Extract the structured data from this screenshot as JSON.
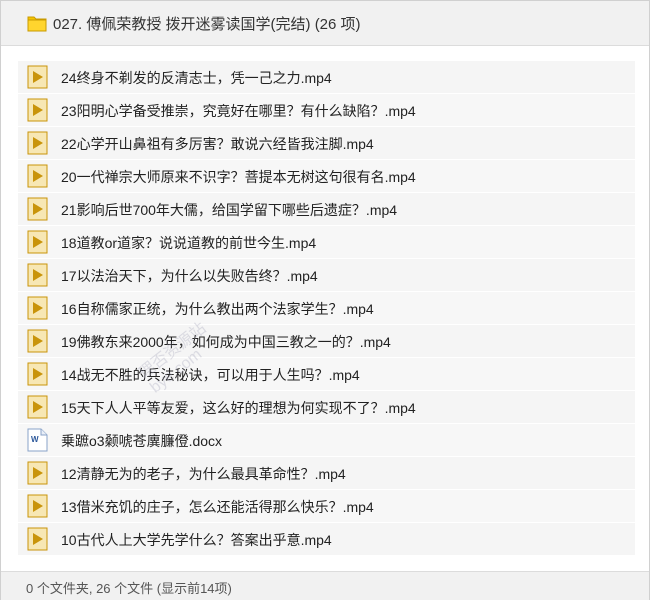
{
  "folder": {
    "title": "027. 傅佩荣教授 拨开迷雾读国学(完结) (26 项)",
    "icon": "folder-icon"
  },
  "files": [
    {
      "name": "24终身不剃发的反清志士，凭一己之力.mp4",
      "icon": "video-icon"
    },
    {
      "name": "23阳明心学备受推崇，究竟好在哪里？有什么缺陷？.mp4",
      "icon": "video-icon"
    },
    {
      "name": "22心学开山鼻祖有多厉害？敢说六经皆我注脚.mp4",
      "icon": "video-icon"
    },
    {
      "name": "20一代禅宗大师原来不识字？菩提本无树这句很有名.mp4",
      "icon": "video-icon"
    },
    {
      "name": "21影响后世700年大儒，给国学留下哪些后遗症？.mp4",
      "icon": "video-icon"
    },
    {
      "name": "18道教or道家？说说道教的前世今生.mp4",
      "icon": "video-icon"
    },
    {
      "name": "17以法治天下，为什么以失败告终？.mp4",
      "icon": "video-icon"
    },
    {
      "name": "16自称儒家正统，为什么教出两个法家学生？.mp4",
      "icon": "video-icon"
    },
    {
      "name": "19佛教东来2000年，如何成为中国三教之一的？.mp4",
      "icon": "video-icon"
    },
    {
      "name": "14战无不胜的兵法秘诀，可以用于人生吗？.mp4",
      "icon": "video-icon"
    },
    {
      "name": "15天下人人平等友爱，这么好的理想为何实现不了？.mp4",
      "icon": "video-icon"
    },
    {
      "name": "乗蹠o3颡唬苍廙臁僜.docx",
      "icon": "word-doc-icon"
    },
    {
      "name": "12清静无为的老子，为什么最具革命性？.mp4",
      "icon": "video-icon"
    },
    {
      "name": "13借米充饥的庄子，怎么还能活得那么快乐？.mp4",
      "icon": "video-icon"
    },
    {
      "name": "10古代人上大学先学什么？答案出乎意.mp4",
      "icon": "video-icon"
    }
  ],
  "footer": {
    "summary": "0 个文件夹, 26 个文件 (显示前14项)"
  },
  "watermark": {
    "line1": "理否资源站",
    "line2": "bye.com"
  },
  "colors": {
    "folder": "#f5c400",
    "video_icon_bg": "#f7e7b4",
    "video_icon_play": "#c9940a",
    "word_blue": "#2b579a"
  }
}
